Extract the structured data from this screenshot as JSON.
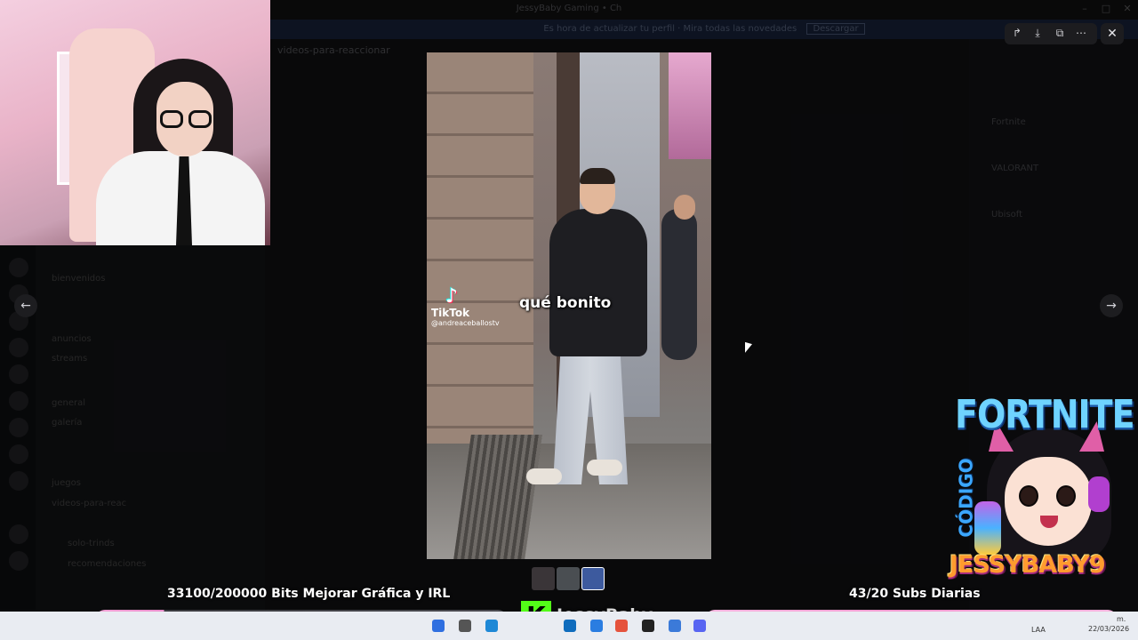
{
  "window": {
    "title": "JessyBaby Gaming • Ch"
  },
  "notice": {
    "text": "Es hora de actualizar tu perfil · Mira todas las novedades",
    "button": "Descargar"
  },
  "chat": {
    "channel": "videos-para-reaccionar"
  },
  "channels": [
    "bienvenidos",
    "anuncios",
    "streams",
    "general",
    "galería",
    "juegos",
    "videos-para-reac",
    "solo-trinds",
    "recomendaciones"
  ],
  "members": [
    "Fortnite",
    "VALORANT",
    "Ubisoft"
  ],
  "media": {
    "caption": "qué bonito",
    "watermark_brand": "TikTok",
    "watermark_user": "@andreaceballostv"
  },
  "viewer": {
    "tools": [
      "forward-icon",
      "download-icon",
      "open-external-icon",
      "more-icon"
    ],
    "close_glyph": "✕",
    "prev_glyph": "←",
    "next_glyph": "→"
  },
  "overlay": {
    "bits_goal": "33100/200000 Bits Mejorar Gráfica y IRL",
    "subs_goal": "43/20 Subs Diarias",
    "bits_progress": 0.1655,
    "kick_glyph": "K",
    "kick_name": "JessyBaby"
  },
  "promo": {
    "title": "FORTNITE",
    "label": "CÓDIGO",
    "code": "JESSYBABY9"
  },
  "taskbar": {
    "lang": "LAA",
    "ampm": "m.",
    "date": "22/03/2026"
  },
  "colors": {
    "kick": "#53fc18",
    "bar_pink": "#f3a3d6",
    "discord_notice": "#1d2a4a"
  }
}
